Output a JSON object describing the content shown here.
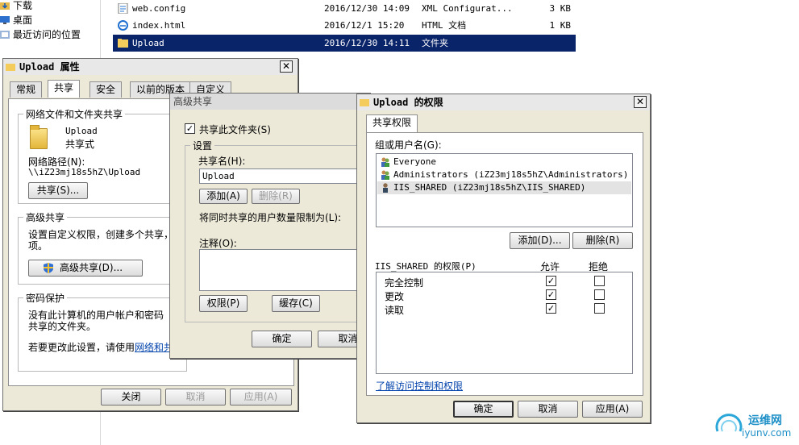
{
  "nav": {
    "items": [
      {
        "label": "下载",
        "icon": "download-folder-icon"
      },
      {
        "label": "桌面",
        "icon": "desktop-icon"
      },
      {
        "label": "最近访问的位置",
        "icon": "recent-places-icon"
      }
    ]
  },
  "files": [
    {
      "name": "web.config",
      "date": "2016/12/30 14:09",
      "type": "XML Configurat...",
      "size": "3 KB",
      "icon": "xml-file-icon"
    },
    {
      "name": "index.html",
      "date": "2016/12/1 15:20",
      "type": "HTML 文档",
      "size": "1 KB",
      "icon": "html-file-icon"
    },
    {
      "name": "Upload",
      "date": "2016/12/30 14:11",
      "type": "文件夹",
      "size": "",
      "icon": "folder-icon"
    }
  ],
  "props": {
    "title": "Upload 属性",
    "close": "✕",
    "tabs": [
      "常规",
      "共享",
      "安全",
      "以前的版本",
      "自定义"
    ],
    "net_group": "网络文件和文件夹共享",
    "folder_name": "Upload",
    "share_state": "共享式",
    "net_path_label": "网络路径(N):",
    "net_path": "\\\\iZ23mj18s5hZ\\Upload",
    "share_btn": "共享(S)...",
    "adv_group": "高级共享",
    "adv_desc1": "设置自定义权限，创建多个共享，",
    "adv_desc2": "项。",
    "adv_btn": "高级共享(D)...",
    "pwd_group": "密码保护",
    "pwd_desc1": "没有此计算机的用户帐户和密码",
    "pwd_desc2": "共享的文件夹。",
    "change_prefix": "若要更改此设置，请使用",
    "change_link": "网络和共",
    "close_btn": "关闭",
    "cancel_btn": "取消",
    "apply_btn": "应用(A)"
  },
  "adv": {
    "title": "高级共享",
    "share_check": "共享此文件夹(S)",
    "share_checked": true,
    "settings_group": "设置",
    "share_name_label": "共享名(H):",
    "share_name": "Upload",
    "add_btn": "添加(A)",
    "remove_btn": "删除(R)",
    "limit_label": "将同时共享的用户数量限制为(L):",
    "comment_label": "注释(O):",
    "perm_btn": "权限(P)",
    "cache_btn": "缓存(C)",
    "ok_btn": "确定",
    "cancel_btn": "取消"
  },
  "perm": {
    "title": "Upload 的权限",
    "close": "✕",
    "tab": "共享权限",
    "group_label": "组或用户名(G):",
    "users": [
      {
        "name": "Everyone",
        "selected": false
      },
      {
        "name": "Administrators (iZ23mj18s5hZ\\Administrators)",
        "selected": false
      },
      {
        "name": "IIS_SHARED (iZ23mj18s5hZ\\IIS_SHARED)",
        "selected": true
      }
    ],
    "add_btn": "添加(D)...",
    "remove_btn": "删除(R)",
    "perm_for": "IIS_SHARED 的权限(P)",
    "allow_col": "允许",
    "deny_col": "拒绝",
    "rows": [
      {
        "label": "完全控制",
        "allow": true,
        "deny": false
      },
      {
        "label": "更改",
        "allow": true,
        "deny": false
      },
      {
        "label": "读取",
        "allow": true,
        "deny": false
      }
    ],
    "learn_link": "了解访问控制和权限",
    "ok_btn": "确定",
    "cancel_btn": "取消",
    "apply_btn": "应用(A)"
  },
  "watermark": {
    "brand": "运维网",
    "domain": "iyunv.com"
  }
}
